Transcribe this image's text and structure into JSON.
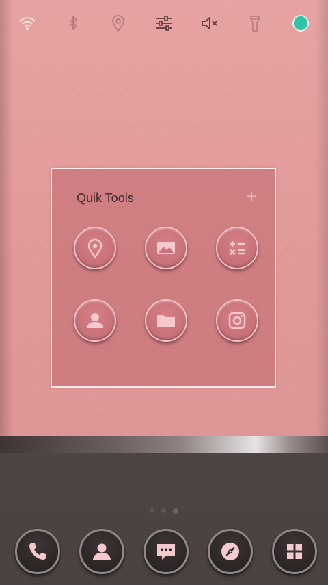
{
  "status_toggles": [
    {
      "icon": "wifi-icon"
    },
    {
      "icon": "bluetooth-icon"
    },
    {
      "icon": "location-icon"
    },
    {
      "icon": "settings-sliders-icon"
    },
    {
      "icon": "mute-icon"
    },
    {
      "icon": "flashlight-icon"
    },
    {
      "icon": "battery-icon",
      "badge_color": "#2fc4a8"
    }
  ],
  "folder": {
    "title": "Quik Tools",
    "add_label": "+",
    "apps": [
      {
        "icon": "maps-pin-icon"
      },
      {
        "icon": "gallery-icon"
      },
      {
        "icon": "calculator-icon"
      },
      {
        "icon": "contacts-icon"
      },
      {
        "icon": "file-manager-icon"
      },
      {
        "icon": "camera-icon"
      }
    ]
  },
  "page_indicator": {
    "count": 3,
    "active_index": 2
  },
  "dock": [
    {
      "icon": "phone-icon"
    },
    {
      "icon": "contacts-icon"
    },
    {
      "icon": "messages-icon"
    },
    {
      "icon": "browser-compass-icon"
    },
    {
      "icon": "app-drawer-icon"
    }
  ],
  "colors": {
    "wallpaper": "#e39b9b",
    "icon_pink": "#f6c9cc",
    "dock_bg": "#4a4141",
    "toggle_icon": "#b57a7e"
  }
}
